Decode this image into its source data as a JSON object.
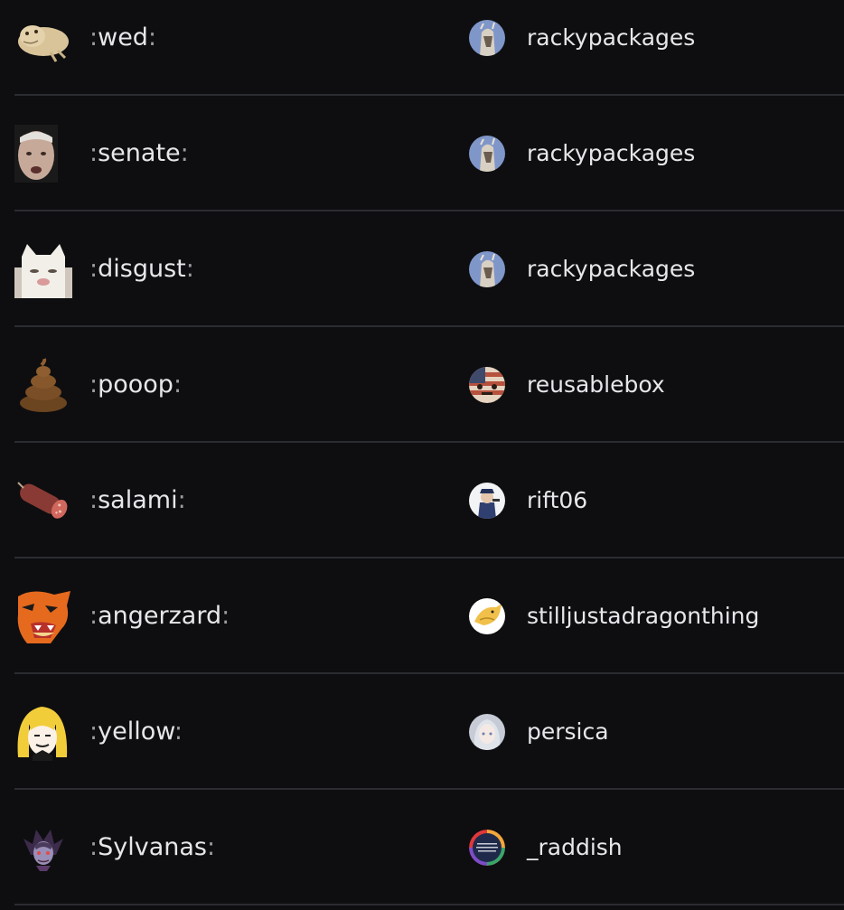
{
  "emoji_list": {
    "rows": [
      {
        "name": "wed",
        "emoji_icon": "frog-emoji-icon",
        "uploader": "rackypackages",
        "avatar_icon": "anime-avatar-icon"
      },
      {
        "name": "senate",
        "emoji_icon": "senator-face-emoji-icon",
        "uploader": "rackypackages",
        "avatar_icon": "anime-avatar-icon"
      },
      {
        "name": "disgust",
        "emoji_icon": "disgusted-cat-emoji-icon",
        "uploader": "rackypackages",
        "avatar_icon": "anime-avatar-icon"
      },
      {
        "name": "pooop",
        "emoji_icon": "poop-emoji-icon",
        "uploader": "reusablebox",
        "avatar_icon": "flag-box-avatar-icon"
      },
      {
        "name": "salami",
        "emoji_icon": "salami-emoji-icon",
        "uploader": "rift06",
        "avatar_icon": "soldier-avatar-icon"
      },
      {
        "name": "angerzard",
        "emoji_icon": "angry-charizard-emoji-icon",
        "uploader": "stilljustadragonthing",
        "avatar_icon": "dragon-avatar-icon"
      },
      {
        "name": "yellow",
        "emoji_icon": "yellow-hair-girl-emoji-icon",
        "uploader": "persica",
        "avatar_icon": "silver-hair-avatar-icon"
      },
      {
        "name": "Sylvanas",
        "emoji_icon": "sylvanas-emoji-icon",
        "uploader": "_raddish",
        "avatar_icon": "rainbow-ring-avatar-icon"
      }
    ]
  },
  "colors": {
    "background": "#0e0e10",
    "divider": "#2b2c31",
    "text": "#e6e7ea",
    "colon": "#9b9ca3"
  }
}
